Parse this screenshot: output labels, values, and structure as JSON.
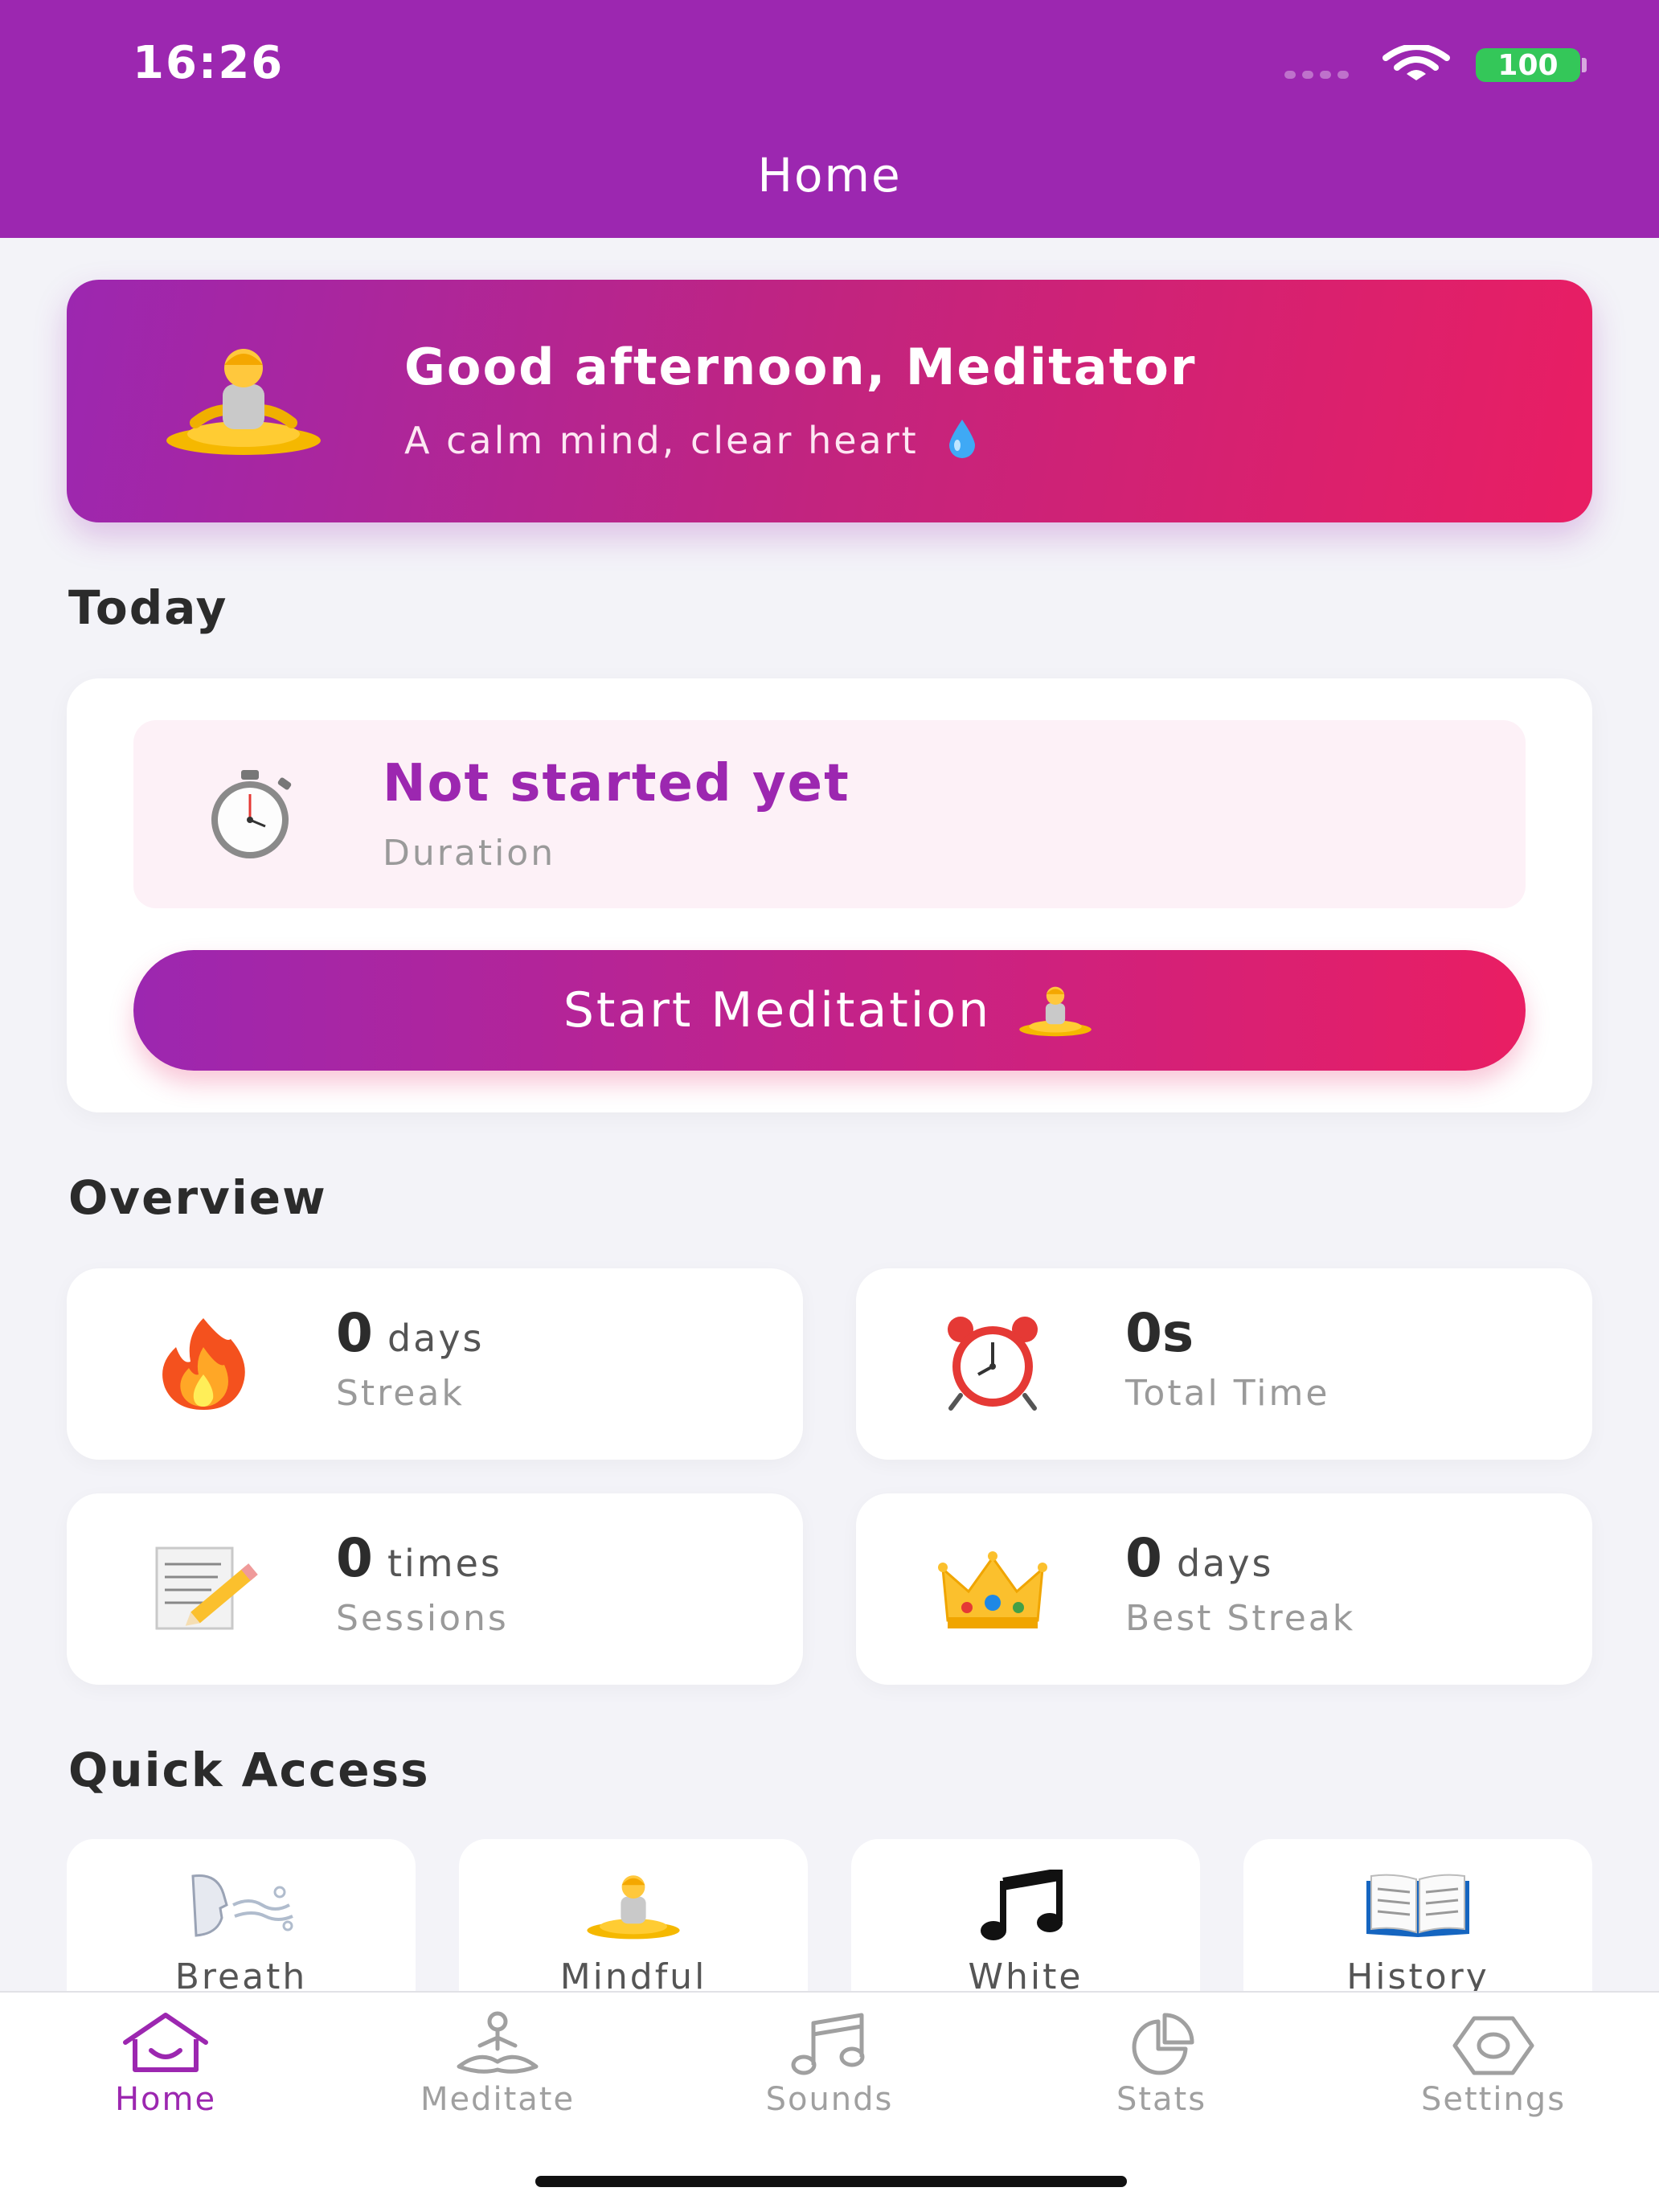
{
  "status_bar": {
    "time": "16:26",
    "battery": "100"
  },
  "header": {
    "title": "Home"
  },
  "greeting": {
    "title": "Good afternoon, Meditator",
    "subtitle": "A calm mind, clear heart"
  },
  "today": {
    "section_title": "Today",
    "duration_status": "Not started yet",
    "duration_label": "Duration",
    "start_button": "Start Meditation"
  },
  "overview": {
    "section_title": "Overview",
    "stats": [
      {
        "value": "0",
        "unit": "days",
        "label": "Streak",
        "icon": "fire-icon"
      },
      {
        "value": "0s",
        "unit": "",
        "label": "Total Time",
        "icon": "alarm-clock-icon"
      },
      {
        "value": "0",
        "unit": "times",
        "label": "Sessions",
        "icon": "memo-icon"
      },
      {
        "value": "0",
        "unit": "days",
        "label": "Best Streak",
        "icon": "crown-icon"
      }
    ]
  },
  "quick_access": {
    "section_title": "Quick Access",
    "items": [
      {
        "label": "Breath",
        "icon": "breath-icon"
      },
      {
        "label": "Mindful",
        "icon": "meditating-person-icon"
      },
      {
        "label": "White",
        "icon": "music-note-icon"
      },
      {
        "label": "History",
        "icon": "book-icon"
      }
    ]
  },
  "tabs": [
    {
      "label": "Home",
      "icon": "home-icon",
      "active": true
    },
    {
      "label": "Meditate",
      "icon": "meditate-icon",
      "active": false
    },
    {
      "label": "Sounds",
      "icon": "music-icon",
      "active": false
    },
    {
      "label": "Stats",
      "icon": "pie-chart-icon",
      "active": false
    },
    {
      "label": "Settings",
      "icon": "settings-icon",
      "active": false
    }
  ],
  "colors": {
    "primary": "#9c27b0",
    "accent": "#e91e63",
    "background": "#f3f3f8",
    "battery": "#34c759"
  }
}
